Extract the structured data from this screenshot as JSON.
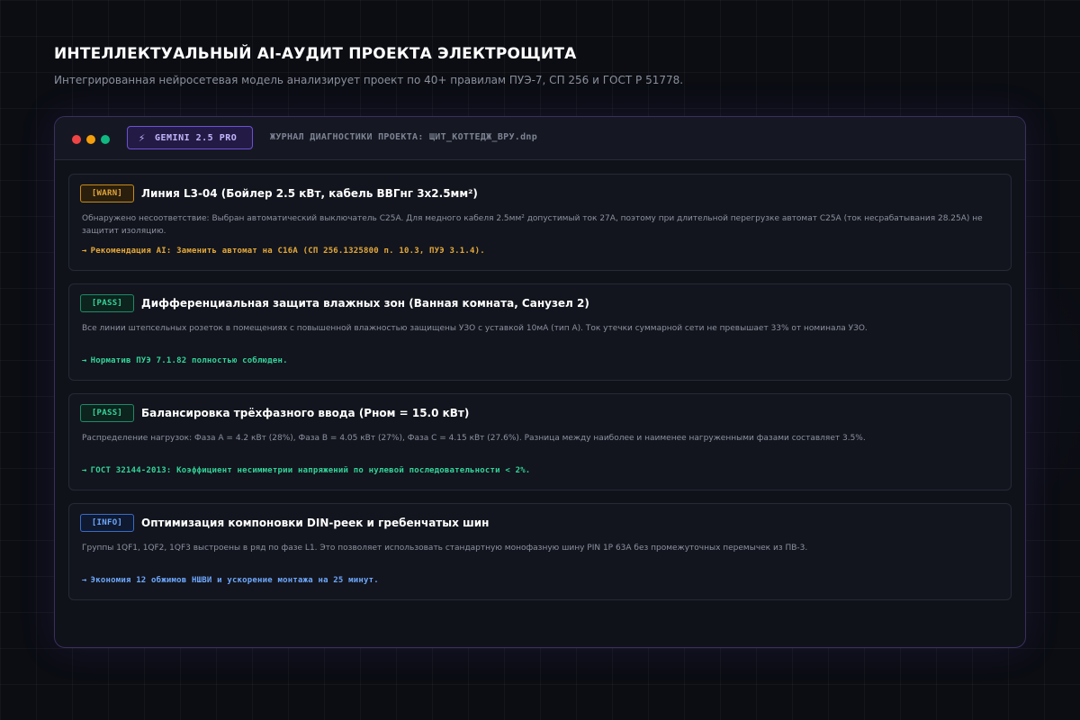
{
  "header": {
    "title": "ИНТЕЛЛЕКТУАЛЬНЫЙ AI-АУДИТ ПРОЕКТА ЭЛЕКТРОЩИТА",
    "subtitle": "Интегрированная нейросетевая модель анализирует проект по 40+ правилам ПУЭ-7, СП 256 и ГОСТ Р 51778."
  },
  "window": {
    "model_badge": "GEMINI 2.5 PRO",
    "model_icon": "⚡",
    "log_title": "ЖУРНАЛ ДИАГНОСТИКИ ПРОЕКТА: ЩИТ_КОТТЕДЖ_ВРУ.dnp"
  },
  "colors": {
    "warn": "#e0a33a",
    "pass": "#34d399",
    "info": "#6ea8fe",
    "accent": "#6d4fd8"
  },
  "items": [
    {
      "status": "[WARN]",
      "title": "Линия L3-04 (Бойлер 2.5 кВт, кабель ВВГнг 3x2.5мм²)",
      "description": "Обнаружено несоответствие: Выбран автоматический выключатель C25A. Для медного кабеля 2.5мм² допустимый ток 27A, поэтому при длительной перегрузке автомат C25A (ток несрабатывания 28.25A) не защитит изоляцию.",
      "recommendation": "Рекомендация AI: Заменить автомат на C16A (СП 256.1325800 п. 10.3, ПУЭ 3.1.4)."
    },
    {
      "status": "[PASS]",
      "title": "Дифференциальная защита влажных зон (Ванная комната, Санузел 2)",
      "description": "Все линии штепсельных розеток в помещениях с повышенной влажностью защищены УЗО с уставкой 10мА (тип А). Ток утечки суммарной сети не превышает 33% от номинала УЗО.",
      "recommendation": "Норматив ПУЭ 7.1.82 полностью соблюден."
    },
    {
      "status": "[PASS]",
      "title": "Балансировка трёхфазного ввода (Pном = 15.0 кВт)",
      "description": "Распределение нагрузок: Фаза A = 4.2 кВт (28%), Фаза B = 4.05 кВт (27%), Фаза C = 4.15 кВт (27.6%). Разница между наиболее и наименее нагруженными фазами составляет 3.5%.",
      "recommendation": "ГОСТ 32144-2013: Коэффициент несимметрии напряжений по нулевой последовательности < 2%."
    },
    {
      "status": "[INFO]",
      "title": "Оптимизация компоновки DIN-реек и гребенчатых шин",
      "description": "Группы 1QF1, 1QF2, 1QF3 выстроены в ряд по фазе L1. Это позволяет использовать стандартную монофазную шину PIN 1P 63A без промежуточных перемычек из ПВ-3.",
      "recommendation": "Экономия 12 обжимов НШВИ и ускорение монтажа на 25 минут."
    }
  ],
  "arrow": "→"
}
